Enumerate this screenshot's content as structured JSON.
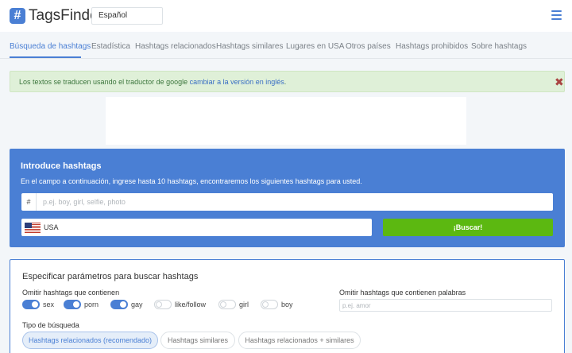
{
  "header": {
    "logo_symbol": "#",
    "logo_text": "TagsFinder",
    "language": "Español",
    "menu_icon": "hamburger-icon"
  },
  "nav": {
    "items": [
      {
        "label": "Búsqueda de hashtags",
        "active": true
      },
      {
        "label": "Estadística"
      },
      {
        "label": "Hashtags relacionados"
      },
      {
        "label": "Hashtags similares"
      },
      {
        "label": "Lugares en USA"
      },
      {
        "label": "Otros países"
      },
      {
        "label": "Hashtags prohibidos"
      },
      {
        "label": "Sobre hashtags"
      }
    ]
  },
  "alert": {
    "text": "Los textos se traducen usando el traductor de google ",
    "link": "cambiar a la versión en inglés",
    "suffix": ".",
    "close": "✖"
  },
  "search": {
    "title": "Introduce hashtags",
    "description": "En el campo a continuación, ingrese hasta 10 hashtags, encontraremos los siguientes hashtags para usted.",
    "prefix": "#",
    "placeholder": "p.ej. boy, girl, selfie, photo",
    "country": "USA",
    "country_flag": "us-flag-icon",
    "button": "¡Buscar!"
  },
  "params": {
    "title": "Especificar parámetros para buscar hashtags",
    "omit_label": "Omitir hashtags que contienen",
    "toggles": [
      {
        "label": "sex",
        "on": true
      },
      {
        "label": "porn",
        "on": true
      },
      {
        "label": "gay",
        "on": true
      },
      {
        "label": "like/follow",
        "on": false
      },
      {
        "label": "girl",
        "on": false
      },
      {
        "label": "boy",
        "on": false
      }
    ],
    "omit_words_label": "Omitir hashtags que contienen palabras",
    "omit_words_placeholder": "p.ej. amor",
    "type_label": "Tipo de búsqueda",
    "types": [
      {
        "label": "Hashtags relacionados (recomendado)",
        "active": true
      },
      {
        "label": "Hashtags similares"
      },
      {
        "label": "Hashtags relacionados + similares"
      }
    ]
  },
  "colors": {
    "brand": "#4a7fd4",
    "success": "#5cb811",
    "alert_bg": "#dff0d8",
    "alert_text": "#3c763d",
    "close": "#a94442"
  }
}
